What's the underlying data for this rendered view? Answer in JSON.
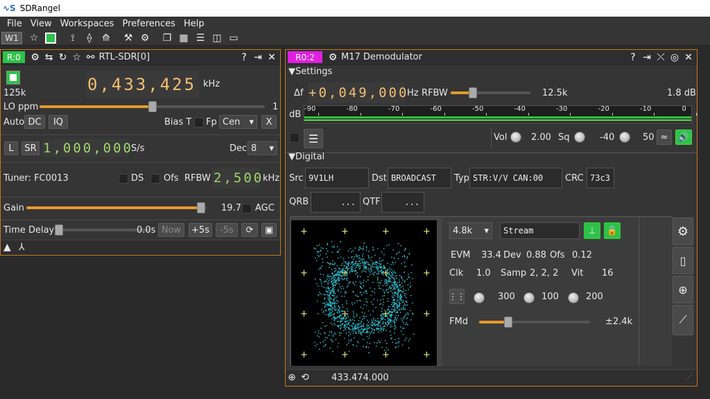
{
  "app": {
    "title": "SDRangel"
  },
  "menu": [
    "File",
    "View",
    "Workspaces",
    "Preferences",
    "Help"
  ],
  "toolbar": {
    "workspace": "W1"
  },
  "device": {
    "tag": "R:0",
    "name": "RTL-SDR[0]",
    "freq": "0,433,425",
    "freq_unit": "kHz",
    "rate": "125k",
    "lo_label": "LO ppm",
    "lo_value": "1",
    "lo_level": 0.5,
    "auto": "Auto",
    "dc": "DC",
    "iq": "IQ",
    "biast": "Bias T",
    "fp": "Fp",
    "fp_sel": "Cen",
    "x": "X",
    "l": "L",
    "sr": "SR",
    "sr_value": "1,000,000",
    "sr_unit": "S/s",
    "dec_label": "Dec",
    "dec_value": "8",
    "tuner": "Tuner: FC0013",
    "ds": "DS",
    "ofs": "Ofs",
    "rfbw": "RFBW",
    "rfbw_value": "2,500",
    "rfbw_unit": "kHz",
    "gain_label": "Gain",
    "gain_value": "19.7",
    "gain_level": 0.97,
    "agc": "AGC",
    "td_label": "Time Delay",
    "td_value": "0.0s",
    "now": "Now",
    "p5": "+5s",
    "m5": "-5s"
  },
  "demod": {
    "tag": "R0:2",
    "name": "M17 Demodulator",
    "settings": "Settings",
    "df": "Δf",
    "df_value": "+0,049,000",
    "df_unit": "Hz",
    "rfbw": "RFBW",
    "rfbw_value": "12.5k",
    "rfbw_level": 0.28,
    "db_val": "1.8 dB",
    "db": "dB",
    "scale": [
      "-90",
      "-80",
      "-70",
      "-60",
      "-50",
      "-40",
      "-30",
      "-20",
      "-10",
      "0"
    ],
    "vol": "Vol",
    "vol_value": "2.00",
    "sq": "Sq",
    "sq_value": "-40",
    "sq2": "50",
    "digital": "Digital",
    "src": "Src",
    "src_v": "9V1LH",
    "dst": "Dst",
    "dst_v": "BROADCAST",
    "typ": "Typ",
    "typ_v": "STR:V/V CAN:00",
    "crc": "CRC",
    "crc_v": "73c3",
    "qrb": "QRB",
    "qrb_v": "...",
    "qtf": "QTF",
    "qtf_v": "...",
    "baud": "4.8k",
    "stream": "Stream",
    "evm": "EVM",
    "evm_v": "33.4",
    "dev": "Dev",
    "dev_v": "0.88",
    "ofs": "Ofs",
    "ofs_v": "0.12",
    "clk": "Clk",
    "clk_v": "1.0",
    "samp": "Samp",
    "samp_v": "2, 2, 2",
    "vit": "Vit",
    "vit_v": "16",
    "d1": "300",
    "d2": "100",
    "d3": "200",
    "fmd": "FMd",
    "fmd_v": "±2.4k",
    "fmd_level": 0.26,
    "freq": "433.474.000"
  }
}
